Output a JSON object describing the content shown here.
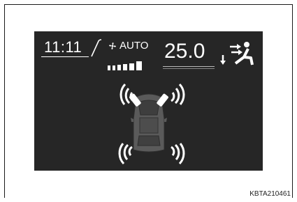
{
  "status_bar": {
    "clock": "11:11",
    "fan_mode": "AUTO",
    "temperature": "25.0",
    "fan_level_shown": 5,
    "fan_level_max": 6
  },
  "sensors": {
    "front_left": "active",
    "front_right": "active",
    "rear_left": "active",
    "rear_right": "active"
  },
  "colors": {
    "screen_background": "#262626",
    "text": "#ffffff",
    "vehicle_body": "#5a5a5a",
    "sensor_indicator": "#ffffff"
  },
  "icons": [
    "fan-icon",
    "airflow-icon",
    "vehicle-icon",
    "sensor-wave-icon"
  ],
  "figure_code": "KBTA210461"
}
